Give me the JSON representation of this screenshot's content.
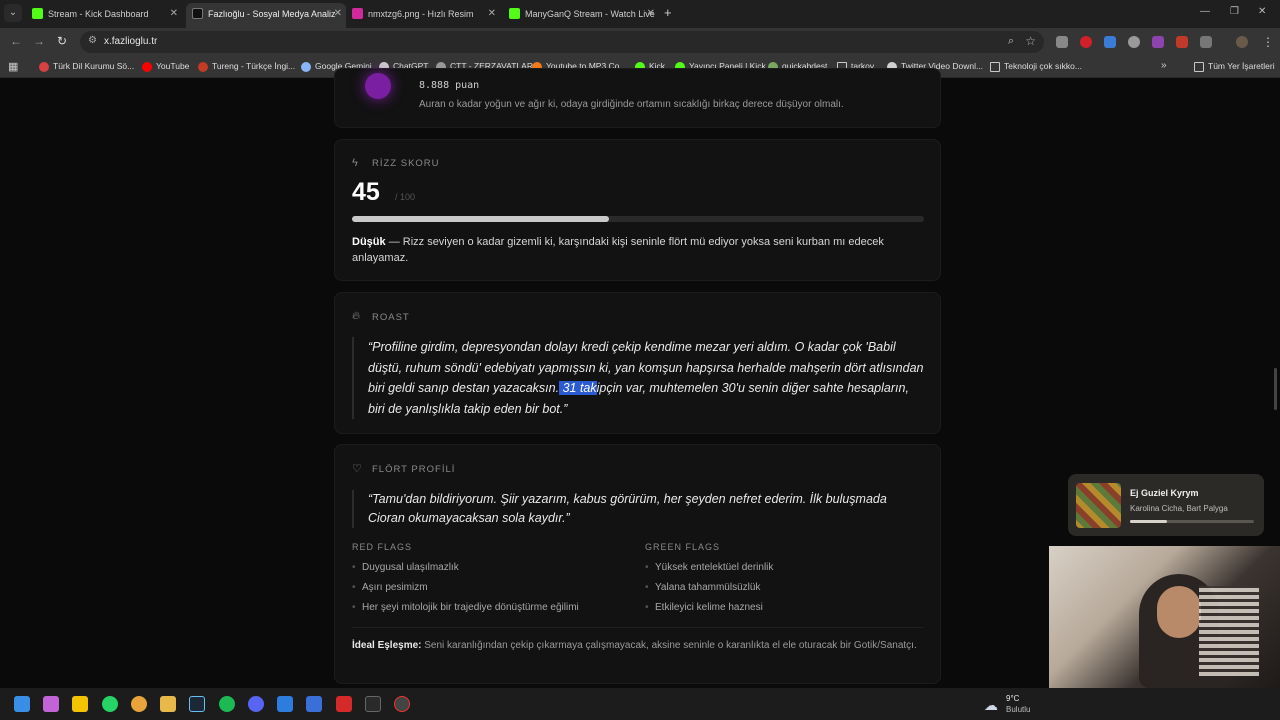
{
  "tabs": [
    {
      "label": "Stream - Kick Dashboard",
      "active": false,
      "color": "#53fc18"
    },
    {
      "label": "Fazlıoğlu - Sosyal Medya Analiz",
      "active": true,
      "color": "#1a1a1a"
    },
    {
      "label": "nmxtzg6.png - Hızlı Resim",
      "active": false,
      "color": "#d12a9a"
    },
    {
      "label": "ManyGanQ Stream - Watch Live",
      "active": false,
      "color": "#53fc18"
    }
  ],
  "address": {
    "url": "x.fazlioglu.tr"
  },
  "bookmarks": [
    {
      "label": "Türk Dil Kurumu Sö...",
      "color": "#d94040"
    },
    {
      "label": "YouTube",
      "color": "#ff0000"
    },
    {
      "label": "Tureng - Türkçe İngi...",
      "color": "#c23b22"
    },
    {
      "label": "Google Gemini",
      "color": "#8ab4f8"
    },
    {
      "label": "ChatGPT",
      "color": "#d0d0d0"
    },
    {
      "label": "ÇTT - ZERZAVATLAR",
      "color": "#999999"
    },
    {
      "label": "Youtube to MP3 Co...",
      "color": "#f07a1a"
    },
    {
      "label": "Kick",
      "color": "#53fc18"
    },
    {
      "label": "Yayıncı Paneli | Kick",
      "color": "#53fc18"
    },
    {
      "label": "quickabdest",
      "color": "#7aa860"
    },
    {
      "label": "tarkov",
      "color": "#c8c8c8"
    },
    {
      "label": "Twitter Video Downl...",
      "color": "#d0d0d0"
    },
    {
      "label": "Teknoloji çok sıkko...",
      "color": "#c8c8c8"
    },
    {
      "label": "Tüm Yer İşaretleri",
      "color": "#c8c8c8"
    }
  ],
  "top_card": {
    "points": "8.888 puan",
    "desc": "Auran o kadar yoğun ve ağır ki, odaya girdiğinde ortamın sıcaklığı birkaç derece düşüyor olmalı."
  },
  "rizz": {
    "label": "RİZZ SKORU",
    "score": "45",
    "max": "/ 100",
    "progress_pct": 45,
    "level": "Düşük",
    "desc": "— Rizz seviyen o kadar gizemli ki, karşındaki kişi seninle flört mü ediyor yoksa seni kurban mı edecek anlayamaz."
  },
  "roast": {
    "label": "ROAST",
    "quote_before": "“Profiline girdim, depresyondan dolayı kredi çekip kendime mezar yeri aldım. O kadar çok 'Babil düştü, ruhum söndü' edebiyatı yapmışsın ki, yan komşun hapşırsa herhalde mahşerin dört atlısından biri geldi sanıp destan yazacaksın.",
    "quote_highlight": " 31 tak",
    "quote_after": "ipçin var, muhtemelen 30'u senin diğer sahte hesapların, biri de yanlışlıkla takip eden bir bot.”"
  },
  "flirt": {
    "label": "FLÖRT PROFİLİ",
    "quote": "“Tamu'dan bildiriyorum. Şiir yazarım, kabus görürüm, her şeyden nefret ederim. İlk buluşmada Cioran okumayacaksan sola kaydır.”",
    "red_label": "RED FLAGS",
    "red": [
      "Duygusal ulaşılmazlık",
      "Aşırı pesimizm",
      "Her şeyi mitolojik bir trajediye dönüştürme eğilimi"
    ],
    "green_label": "GREEN FLAGS",
    "green": [
      "Yüksek entelektüel derinlik",
      "Yalana tahammülsüzlük",
      "Etkileyici kelime haznesi"
    ],
    "ideal_label": "İdeal Eşleşme:",
    "ideal": " Seni karanlığından çekip çıkarmaya çalışmayacak, aksine seninle o karanlıkta el ele oturacak bir Gotik/Sanatçı."
  },
  "media": {
    "title": "Ej Guziel Kyrym",
    "artist": "Karolina Cicha, Bart Palyga",
    "progress": 0.3
  },
  "weather": {
    "temp": "9°C",
    "cond": "Bulutlu"
  }
}
